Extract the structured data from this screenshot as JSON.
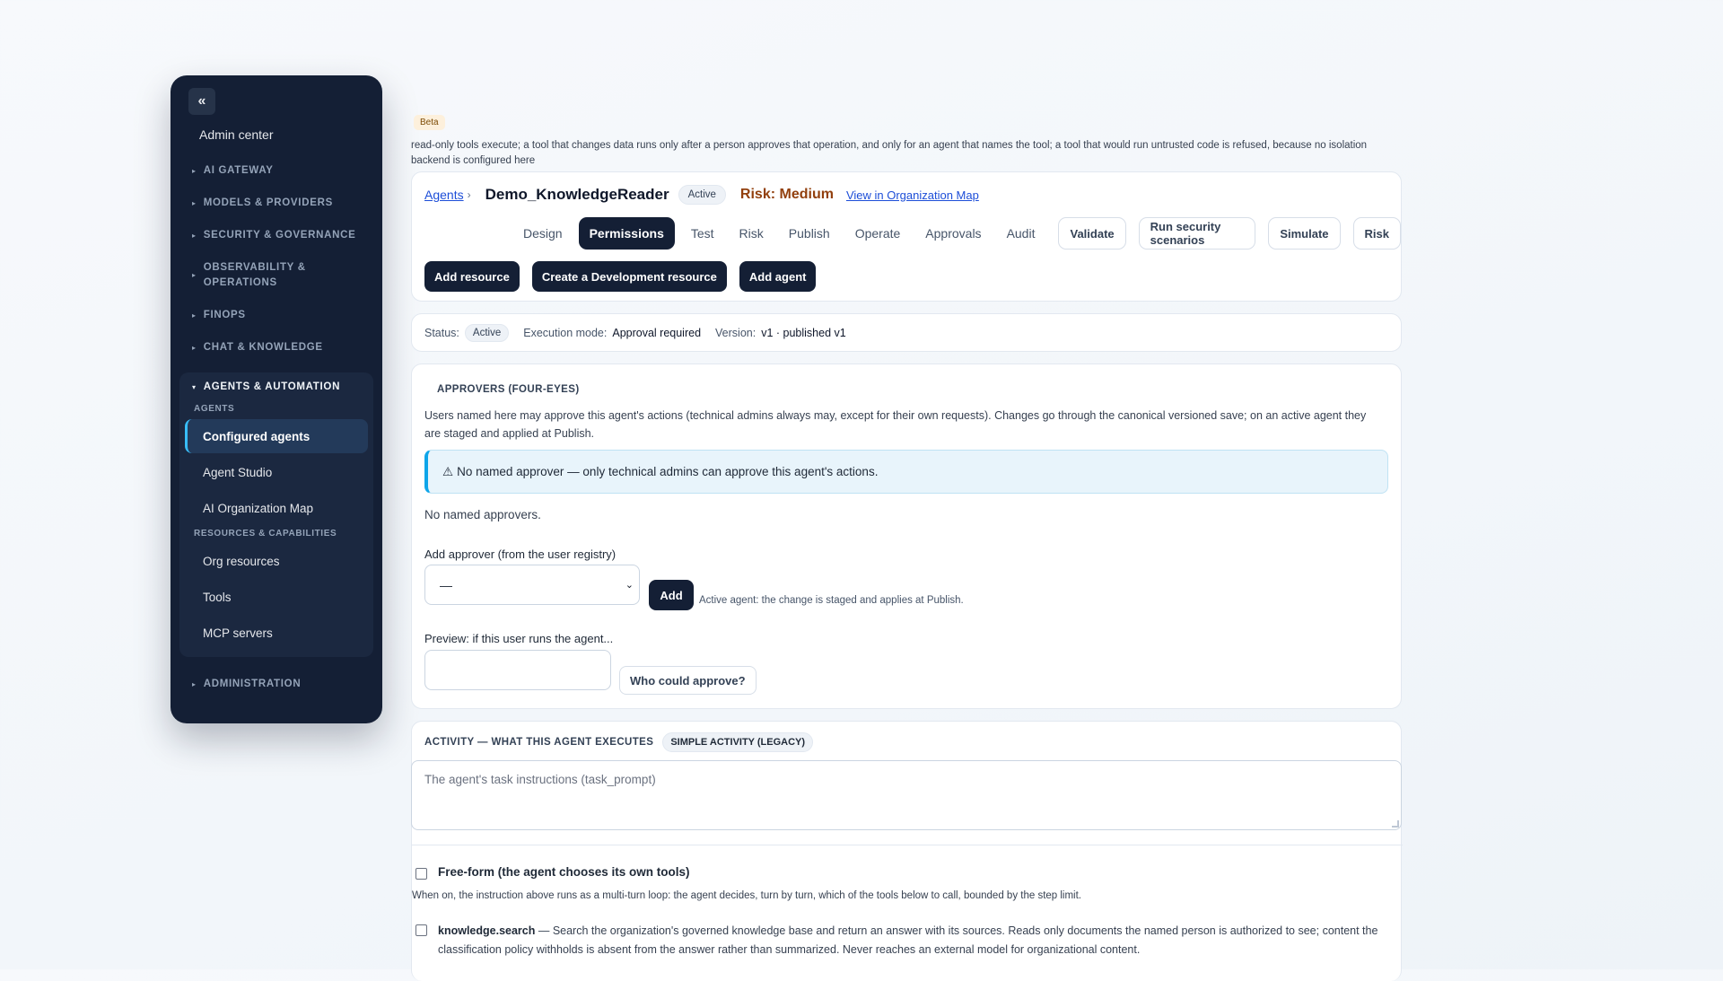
{
  "sidebar": {
    "collapse_glyph": "«",
    "title": "Admin center",
    "sections": [
      {
        "label": "AI GATEWAY"
      },
      {
        "label": "MODELS & PROVIDERS"
      },
      {
        "label": "SECURITY & GOVERNANCE"
      },
      {
        "label": "OBSERVABILITY & OPERATIONS"
      },
      {
        "label": "FINOPS"
      },
      {
        "label": "CHAT & KNOWLEDGE"
      }
    ],
    "expanded": {
      "label": "AGENTS & AUTOMATION",
      "group1_label": "AGENTS",
      "group1_items": [
        "Configured agents",
        "Agent Studio",
        "AI Organization Map"
      ],
      "group2_label": "RESOURCES & CAPABILITIES",
      "group2_items": [
        "Org resources",
        "Tools",
        "MCP servers"
      ]
    },
    "last_section": "ADMINISTRATION"
  },
  "beta_badge": "Beta",
  "intro_text": "read-only tools execute; a tool that changes data runs only after a person approves that operation, and only for an agent that names the tool; a tool that would run untrusted code is refused, because no isolation backend is configured here",
  "header": {
    "breadcrumb": "Agents",
    "breadcrumb_sep": "›",
    "agent_name": "Demo_KnowledgeReader",
    "status_pill": "Active",
    "risk": "Risk: Medium",
    "org_link": "View in Organization Map",
    "tabs": [
      "Design",
      "Permissions",
      "Test",
      "Risk",
      "Publish",
      "Operate",
      "Approvals",
      "Audit"
    ],
    "active_tab": "Permissions",
    "outline_buttons": [
      "Validate",
      "Run security scenarios",
      "Simulate",
      "Risk"
    ],
    "actions": [
      "Add resource",
      "Create a Development resource",
      "Add agent"
    ]
  },
  "status_bar": {
    "status_label": "Status:",
    "status_value": "Active",
    "exec_label": "Execution mode:",
    "exec_value": "Approval required",
    "version_label": "Version:",
    "version_value": "v1 · published v1"
  },
  "approvers": {
    "title": "APPROVERS (FOUR-EYES)",
    "description": "Users named here may approve this agent's actions (technical admins always may, except for their own requests). Changes go through the canonical versioned save; on an active agent they are staged and applied at Publish.",
    "warning_icon": "⚠",
    "warning": "No named approver — only technical admins can approve this agent's actions.",
    "empty": "No named approvers.",
    "add_label": "Add approver (from the user registry)",
    "select_value": "—",
    "add_button": "Add",
    "add_note": "Active agent: the change is staged and applies at Publish.",
    "preview_label": "Preview: if this user runs the agent...",
    "preview_value": "",
    "who_button": "Who could approve?"
  },
  "activity": {
    "title": "ACTIVITY — WHAT THIS AGENT EXECUTES",
    "legacy_pill": "SIMPLE ACTIVITY (LEGACY)",
    "task_placeholder": "The agent's task instructions (task_prompt)",
    "freeform_label": "Free-form (the agent chooses its own tools)",
    "freeform_checked": false,
    "freeform_desc": "When on, the instruction above runs as a multi-turn loop: the agent decides, turn by turn, which of the tools below to call, bounded by the step limit.",
    "tool_name": "knowledge.search",
    "tool_checked": false,
    "tool_desc": " — Search the organization's governed knowledge base and return an answer with its sources. Reads only documents the named person is authorized to see; content the classification policy withholds is absent from the answer rather than summarized. Never reaches an external model for organizational content."
  }
}
